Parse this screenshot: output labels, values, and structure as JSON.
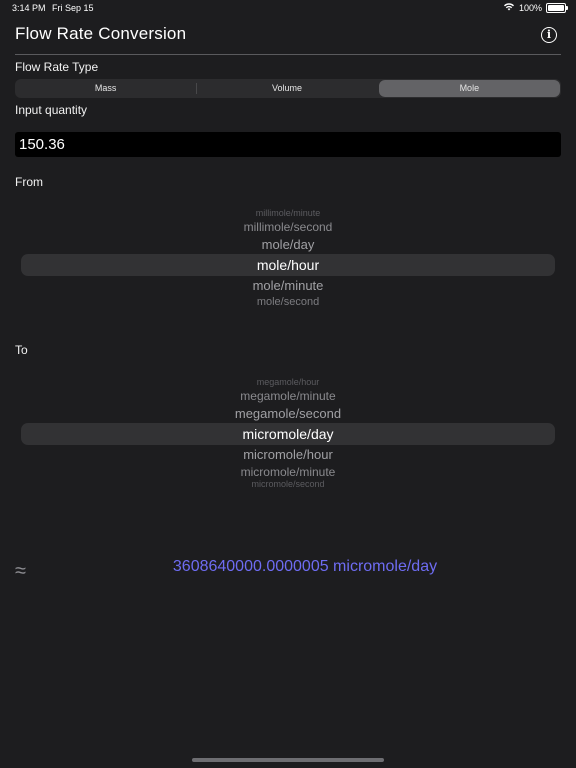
{
  "status_bar": {
    "time": "3:14 PM",
    "date": "Fri Sep 15",
    "battery": "100%"
  },
  "header": {
    "title": "Flow Rate Conversion"
  },
  "flow_rate_type": {
    "label": "Flow Rate Type",
    "options": [
      "Mass",
      "Volume",
      "Mole"
    ],
    "selected": "Mole"
  },
  "input": {
    "label": "Input quantity",
    "value": "150.36"
  },
  "from": {
    "label": "From",
    "items": [
      "millimole/minute",
      "millimole/second",
      "mole/day",
      "mole/hour",
      "mole/minute",
      "mole/second"
    ],
    "selected": "mole/hour"
  },
  "to": {
    "label": "To",
    "items": [
      "megamole/hour",
      "megamole/minute",
      "megamole/second",
      "micromole/day",
      "micromole/hour",
      "micromole/minute",
      "micromole/second"
    ],
    "selected": "micromole/day"
  },
  "result": {
    "approx_symbol": "≈",
    "text": "3608640000.0000005 micromole/day"
  },
  "colors": {
    "background": "#1d1d1f",
    "accent": "#6e6cf2",
    "selected_segment": "#636366"
  }
}
